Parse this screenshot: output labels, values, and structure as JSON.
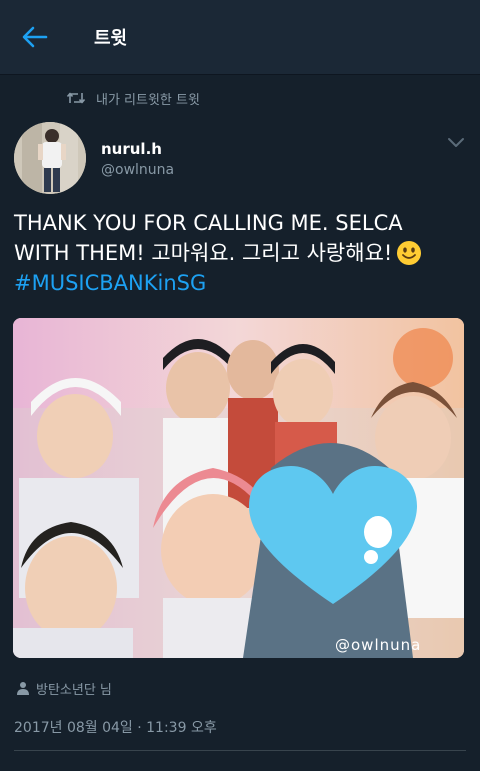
{
  "header": {
    "title": "트윗",
    "back_icon": "arrow-left-icon",
    "accent_color": "#1da1f2"
  },
  "retweet_context": {
    "icon": "retweet-icon",
    "text": "내가 리트윗한 트윗"
  },
  "tweet": {
    "author": {
      "display_name": "nurul.h",
      "username": "@owlnuna",
      "avatar_icon": "avatar"
    },
    "menu_icon": "chevron-down-icon",
    "text_line1": "THANK YOU FOR CALLING ME. SELCA",
    "text_line2": "WITH THEM! 고마워요. 그리고 사랑해요!",
    "emoji": "smiling-face-icon",
    "hashtag": "#MUSICBANKinSG",
    "photo": {
      "watermark": "@owlnuna",
      "sticker": "heart-icon"
    },
    "tagged": {
      "icon": "person-icon",
      "text": "방탄소년단 님"
    },
    "timestamp": "2017년 08월 04일 · 11:39 오후"
  },
  "colors": {
    "background": "#15202b",
    "secondary_text": "#8899a6",
    "heart": "#5ec8f0"
  }
}
